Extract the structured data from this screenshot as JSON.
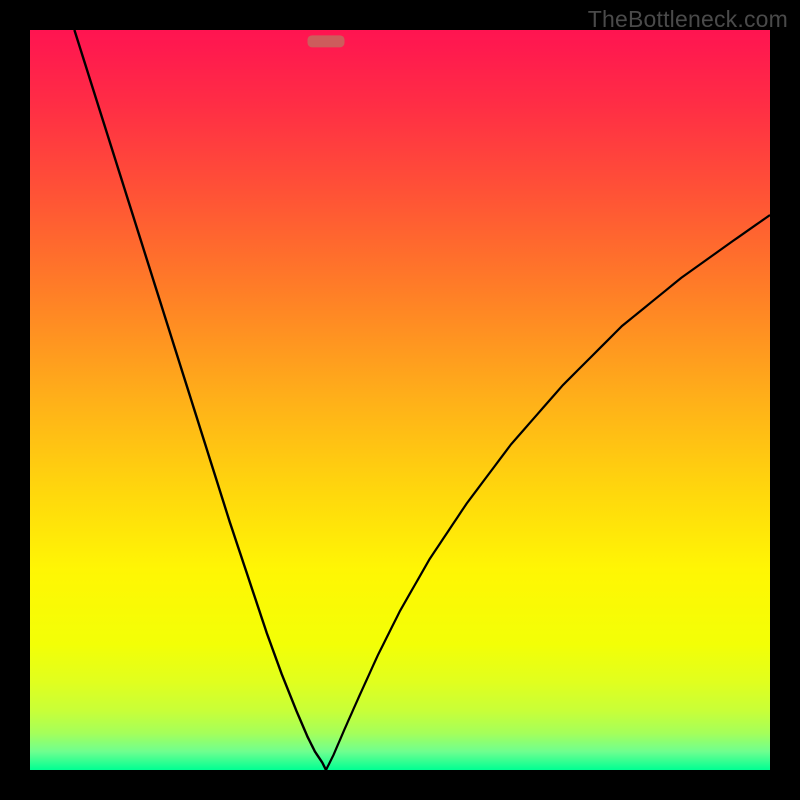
{
  "watermark": "TheBottleneck.com",
  "gradient": {
    "stops": [
      {
        "offset": 0.0,
        "color": "#ff1451"
      },
      {
        "offset": 0.1,
        "color": "#ff2d45"
      },
      {
        "offset": 0.22,
        "color": "#ff5236"
      },
      {
        "offset": 0.35,
        "color": "#ff7d27"
      },
      {
        "offset": 0.5,
        "color": "#ffb019"
      },
      {
        "offset": 0.62,
        "color": "#ffd60d"
      },
      {
        "offset": 0.73,
        "color": "#fff604"
      },
      {
        "offset": 0.83,
        "color": "#f3ff06"
      },
      {
        "offset": 0.88,
        "color": "#e1ff1e"
      },
      {
        "offset": 0.92,
        "color": "#c8ff38"
      },
      {
        "offset": 0.95,
        "color": "#a5ff5a"
      },
      {
        "offset": 0.975,
        "color": "#6fff8f"
      },
      {
        "offset": 1.0,
        "color": "#00ff93"
      }
    ]
  },
  "chart_data": {
    "type": "line",
    "title": "",
    "xlabel": "",
    "ylabel": "",
    "xlim": [
      0,
      1
    ],
    "ylim": [
      0,
      1
    ],
    "optimum_x": 0.4,
    "marker": {
      "x_start": 0.375,
      "x_end": 0.425,
      "y": 0.986,
      "color": "#cd5c5c",
      "rx": 0.006
    },
    "series": [
      {
        "name": "left-curve",
        "x": [
          0.06,
          0.09,
          0.12,
          0.15,
          0.18,
          0.21,
          0.24,
          0.27,
          0.3,
          0.32,
          0.34,
          0.36,
          0.375,
          0.385,
          0.395,
          0.4
        ],
        "y": [
          1.0,
          0.905,
          0.81,
          0.715,
          0.62,
          0.525,
          0.43,
          0.335,
          0.245,
          0.185,
          0.13,
          0.08,
          0.045,
          0.025,
          0.01,
          0.0
        ]
      },
      {
        "name": "right-curve",
        "x": [
          0.4,
          0.41,
          0.425,
          0.445,
          0.47,
          0.5,
          0.54,
          0.59,
          0.65,
          0.72,
          0.8,
          0.88,
          0.95,
          1.0
        ],
        "y": [
          0.0,
          0.02,
          0.055,
          0.1,
          0.155,
          0.215,
          0.285,
          0.36,
          0.44,
          0.52,
          0.6,
          0.665,
          0.715,
          0.75
        ]
      }
    ]
  }
}
